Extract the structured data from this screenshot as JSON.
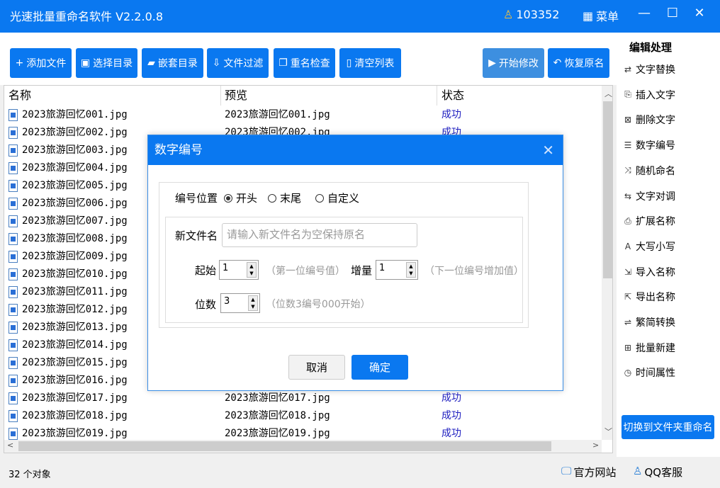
{
  "app": {
    "title": "光速批量重命名软件 V2.2.0.8",
    "user_id": "103352",
    "menu_label": "菜单"
  },
  "toolbar": [
    {
      "label": "添加文件",
      "icon": "+"
    },
    {
      "label": "选择目录",
      "icon": "▣"
    },
    {
      "label": "嵌套目录",
      "icon": "▰"
    },
    {
      "label": "文件过滤",
      "icon": "⇩"
    },
    {
      "label": "重名检查",
      "icon": "❐"
    },
    {
      "label": "清空列表",
      "icon": "▯"
    }
  ],
  "actions": {
    "start": "开始修改",
    "restore": "恢复原名"
  },
  "list": {
    "headers": [
      "名称",
      "预览",
      "状态"
    ],
    "rows": [
      {
        "name": "2023旅游回忆001.jpg",
        "preview": "2023旅游回忆001.jpg",
        "status": "成功"
      },
      {
        "name": "2023旅游回忆002.jpg",
        "preview": "2023旅游回忆002.jpg",
        "status": "成功"
      },
      {
        "name": "2023旅游回忆003.jpg"
      },
      {
        "name": "2023旅游回忆004.jpg"
      },
      {
        "name": "2023旅游回忆005.jpg"
      },
      {
        "name": "2023旅游回忆006.jpg"
      },
      {
        "name": "2023旅游回忆007.jpg"
      },
      {
        "name": "2023旅游回忆008.jpg"
      },
      {
        "name": "2023旅游回忆009.jpg"
      },
      {
        "name": "2023旅游回忆010.jpg"
      },
      {
        "name": "2023旅游回忆011.jpg"
      },
      {
        "name": "2023旅游回忆012.jpg"
      },
      {
        "name": "2023旅游回忆013.jpg"
      },
      {
        "name": "2023旅游回忆014.jpg"
      },
      {
        "name": "2023旅游回忆015.jpg"
      },
      {
        "name": "2023旅游回忆016.jpg"
      },
      {
        "name": "2023旅游回忆017.jpg",
        "preview": "2023旅游回忆017.jpg",
        "status": "成功"
      },
      {
        "name": "2023旅游回忆018.jpg",
        "preview": "2023旅游回忆018.jpg",
        "status": "成功"
      },
      {
        "name": "2023旅游回忆019.jpg",
        "preview": "2023旅游回忆019.jpg",
        "status": "成功"
      }
    ]
  },
  "sidebar": {
    "title": "编辑处理",
    "items": [
      {
        "label": "文字替换",
        "icon": "⇄"
      },
      {
        "label": "插入文字",
        "icon": "⎘"
      },
      {
        "label": "删除文字",
        "icon": "⊠"
      },
      {
        "label": "数字编号",
        "icon": "☰"
      },
      {
        "label": "随机命名",
        "icon": "⤨"
      },
      {
        "label": "文字对调",
        "icon": "⇆"
      },
      {
        "label": "扩展名称",
        "icon": "⎙"
      },
      {
        "label": "大写小写",
        "icon": "A"
      },
      {
        "label": "导入名称",
        "icon": "⇲"
      },
      {
        "label": "导出名称",
        "icon": "⇱"
      },
      {
        "label": "繁简转换",
        "icon": "⇌"
      },
      {
        "label": "批量新建",
        "icon": "⊞"
      },
      {
        "label": "时间属性",
        "icon": "◷"
      }
    ],
    "switch_label": "切换到文件夹重命名"
  },
  "status": {
    "count": "32 个对象",
    "website": "官方网站",
    "qq": "QQ客服"
  },
  "dialog": {
    "title": "数字编号",
    "position_label": "编号位置",
    "options": [
      "开头",
      "末尾",
      "自定义"
    ],
    "selected": "开头",
    "newname_label": "新文件名",
    "newname_placeholder": "请输入新文件名为空保持原名",
    "start_label": "起始",
    "start_value": "1",
    "start_hint": "（第一位编号值）",
    "step_label": "增量",
    "step_value": "1",
    "step_hint": "（下一位编号增加值）",
    "digits_label": "位数",
    "digits_value": "3",
    "digits_hint": "（位数3编号000开始）",
    "cancel": "取消",
    "ok": "确定"
  }
}
